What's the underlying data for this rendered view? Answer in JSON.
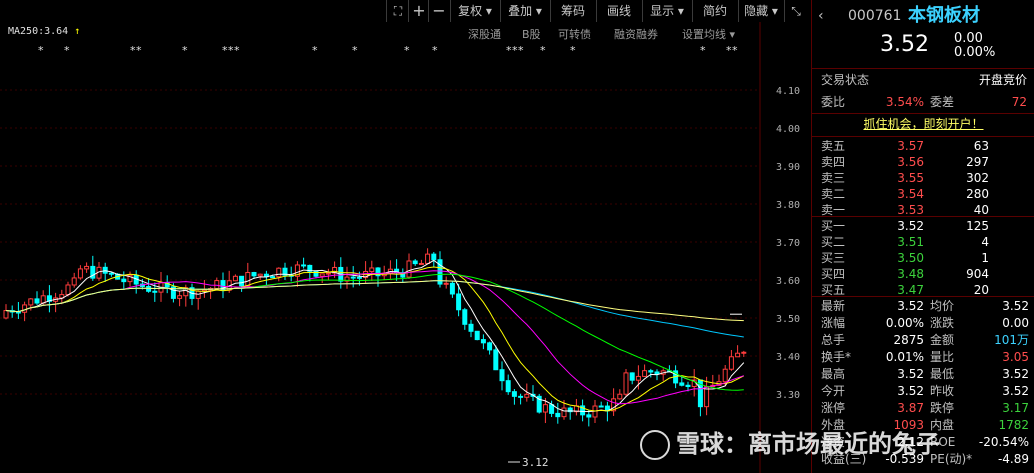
{
  "toolbar": {
    "buttons": [
      "复权",
      "叠加",
      "筹码",
      "画线",
      "显示",
      "简约",
      "隐藏"
    ],
    "icons": [
      "lock-icon",
      "plus-icon",
      "minus-icon",
      "expand-icon"
    ]
  },
  "subbar": {
    "ma_label": "MA250:3.64",
    "links": [
      "深股通",
      "B股",
      "可转债",
      "融资融券",
      "设置均线"
    ]
  },
  "chart": {
    "y_ticks": [
      "4.10",
      "4.00",
      "3.90",
      "3.80",
      "3.70",
      "3.60",
      "3.50",
      "3.40",
      "3.30"
    ],
    "low_marker": "3.12",
    "colors": {
      "up": "#ff3c3c",
      "down": "#00ffff",
      "ma5": "#ffffff",
      "ma10": "#ffff00",
      "ma20": "#ff00ff",
      "ma60": "#00ff00",
      "ma120": "#00c8ff",
      "ma250": "#ffff80"
    }
  },
  "quote": {
    "code": "000761",
    "name": "本钢板材",
    "price": "3.52",
    "change": "0.00",
    "change_pct": "0.00%",
    "status_label": "交易状态",
    "status_value": "开盘竞价",
    "wei_bi_label": "委比",
    "wei_bi": "3.54%",
    "wei_cha_label": "委差",
    "wei_cha": "72",
    "promo": "抓住机会，即刻开户！",
    "asks": [
      {
        "label": "卖五",
        "price": "3.57",
        "vol": "63"
      },
      {
        "label": "卖四",
        "price": "3.56",
        "vol": "297"
      },
      {
        "label": "卖三",
        "price": "3.55",
        "vol": "302"
      },
      {
        "label": "卖二",
        "price": "3.54",
        "vol": "280"
      },
      {
        "label": "卖一",
        "price": "3.53",
        "vol": "40"
      }
    ],
    "bids": [
      {
        "label": "买一",
        "price": "3.52",
        "vol": "125"
      },
      {
        "label": "买二",
        "price": "3.51",
        "vol": "4"
      },
      {
        "label": "买三",
        "price": "3.50",
        "vol": "1"
      },
      {
        "label": "买四",
        "price": "3.48",
        "vol": "904"
      },
      {
        "label": "买五",
        "price": "3.47",
        "vol": "20"
      }
    ],
    "stats": [
      {
        "l1": "最新",
        "v1": "3.52",
        "c1": "white",
        "l2": "均价",
        "v2": "3.52",
        "c2": "white"
      },
      {
        "l1": "涨幅",
        "v1": "0.00%",
        "c1": "white",
        "l2": "涨跌",
        "v2": "0.00",
        "c2": "white"
      },
      {
        "l1": "总手",
        "v1": "2875",
        "c1": "white",
        "l2": "金额",
        "v2": "101万",
        "c2": "cyan"
      },
      {
        "l1": "换手*",
        "v1": "0.01%",
        "c1": "white",
        "l2": "量比",
        "v2": "3.05",
        "c2": "red"
      },
      {
        "l1": "最高",
        "v1": "3.52",
        "c1": "white",
        "l2": "最低",
        "v2": "3.52",
        "c2": "white"
      },
      {
        "l1": "今开",
        "v1": "3.52",
        "c1": "white",
        "l2": "昨收",
        "v2": "3.52",
        "c2": "white"
      },
      {
        "l1": "涨停",
        "v1": "3.87",
        "c1": "red",
        "l2": "跌停",
        "v2": "3.17",
        "c2": "green"
      },
      {
        "l1": "外盘",
        "v1": "1093",
        "c1": "red",
        "l2": "内盘",
        "v2": "1782",
        "c2": "green"
      },
      {
        "l1": "净资",
        "v1": "2.12",
        "c1": "white",
        "l2": "ROE",
        "v2": "-20.54%",
        "c2": "white"
      },
      {
        "l1": "收益(三)",
        "v1": "-0.539",
        "c1": "white",
        "l2": "PE(动)*",
        "v2": "-4.89",
        "c2": "white"
      }
    ]
  },
  "watermark": "雪球：离市场最近的兔子"
}
